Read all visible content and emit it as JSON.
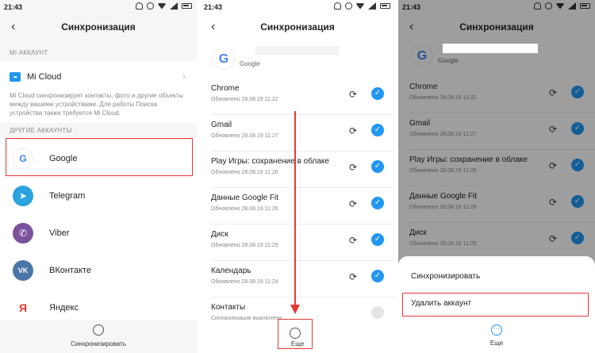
{
  "status": {
    "time": "21:43"
  },
  "panel1": {
    "title": "Синхронизация",
    "mi_section": "MI АККАУНТ",
    "mi_cloud": "Mi Cloud",
    "mi_desc": "Mi Cloud синхронизирует контакты, фото и другие объекты между вашими устройствами. Для работы Поиска устройства также требуется Mi Cloud.",
    "other_section": "ДРУГИЕ АККАУНТЫ",
    "accounts": [
      {
        "name": "Google",
        "icon": "google-icon",
        "color": "#ffffff",
        "letter": "G"
      },
      {
        "name": "Telegram",
        "icon": "telegram-icon",
        "color": "#2aa3de",
        "letter": "➤"
      },
      {
        "name": "Viber",
        "icon": "viber-icon",
        "color": "#7b519d",
        "letter": "✆"
      },
      {
        "name": "ВКонтакте",
        "icon": "vk-icon",
        "color": "#4a76a8",
        "letter": "VK"
      },
      {
        "name": "Яндекс",
        "icon": "yandex-icon",
        "color": "#ffffff",
        "letter": "Я"
      }
    ],
    "bottom_label": "Синхронизировать"
  },
  "panel2": {
    "title": "Синхронизация",
    "account_label": "Google",
    "items": [
      {
        "name": "Chrome",
        "date": "Обновлено 28.08.19 11:22",
        "checked": true
      },
      {
        "name": "Gmail",
        "date": "Обновлено 28.08.19 11:27",
        "checked": true
      },
      {
        "name": "Play Игры: сохранение в облаке",
        "date": "Обновлено 28.08.19 11:26",
        "checked": true
      },
      {
        "name": "Данные Google Fit",
        "date": "Обновлено 28.08.19 11:26",
        "checked": true
      },
      {
        "name": "Диск",
        "date": "Обновлено 28.08.19 11:29",
        "checked": true
      },
      {
        "name": "Календарь",
        "date": "Обновлено 28.08.19 11:24",
        "checked": true
      },
      {
        "name": "Контакты",
        "date": "Синхронизация выключена",
        "checked": false
      }
    ],
    "more_label": "Еще"
  },
  "panel3": {
    "title": "Синхронизация",
    "account_label": "Google",
    "items": [
      {
        "name": "Chrome",
        "date": "Обновлено 28.08.19 11:22"
      },
      {
        "name": "Gmail",
        "date": "Обновлено 28.08.19 11:27"
      },
      {
        "name": "Play Игры: сохранение в облаке",
        "date": "Обновлено 28.08.19 11:26"
      },
      {
        "name": "Данные Google Fit",
        "date": "Обновлено 28.08.19 11:26"
      },
      {
        "name": "Диск",
        "date": "Обновлено 28.08.19 11:29"
      }
    ],
    "menu": [
      "Синхронизировать",
      "Удалить аккаунт"
    ],
    "more_label": "Еще"
  },
  "colors": {
    "accent": "#2196f3",
    "highlight": "#e53935"
  }
}
